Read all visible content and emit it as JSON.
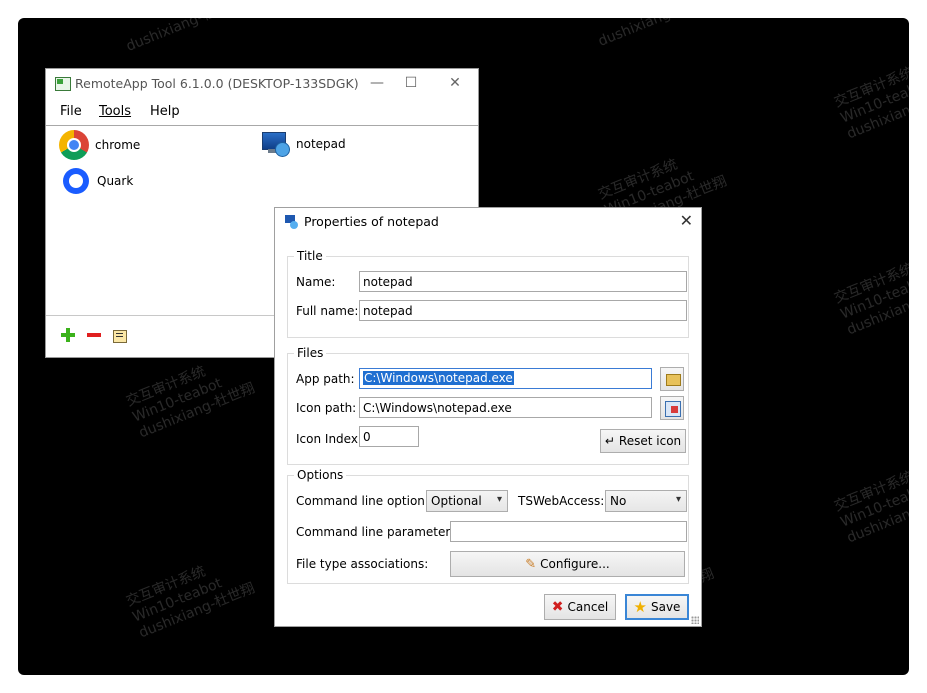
{
  "watermark": {
    "line1": "交互审计系统",
    "line2": "Win10-teabot",
    "line3": "dushixiang-杜世翔"
  },
  "main_window": {
    "title": "RemoteApp Tool 6.1.0.0 (DESKTOP-133SDGK)",
    "menu": [
      "File",
      "Tools",
      "Help"
    ],
    "apps": [
      {
        "name": "chrome",
        "icon": "chrome-icon"
      },
      {
        "name": "notepad",
        "icon": "notepad-icon"
      },
      {
        "name": "Quark",
        "icon": "quark-icon"
      }
    ],
    "controls": {
      "minimize": "—",
      "maximize": "☐",
      "close": "✕"
    }
  },
  "dialog": {
    "title": "Properties of notepad",
    "close": "✕",
    "title_group": {
      "label": "Title",
      "name_label": "Name:",
      "name_value": "notepad",
      "fullname_label": "Full name:",
      "fullname_value": "notepad"
    },
    "files_group": {
      "label": "Files",
      "app_path_label": "App path:",
      "app_path_value": "C:\\Windows\\notepad.exe",
      "icon_path_label": "Icon path:",
      "icon_path_value": "C:\\Windows\\notepad.exe",
      "icon_index_label": "Icon Index:",
      "icon_index_value": "0",
      "reset_icon_label": "Reset icon"
    },
    "options_group": {
      "label": "Options",
      "cmd_option_label": "Command line option:",
      "cmd_option_value": "Optional",
      "tswebaccess_label": "TSWebAccess:",
      "tswebaccess_value": "No",
      "cmd_params_label": "Command line parameters:",
      "cmd_params_value": "",
      "file_assoc_label": "File type associations:",
      "configure_label": "Configure..."
    },
    "buttons": {
      "cancel": "Cancel",
      "save": "Save"
    }
  }
}
